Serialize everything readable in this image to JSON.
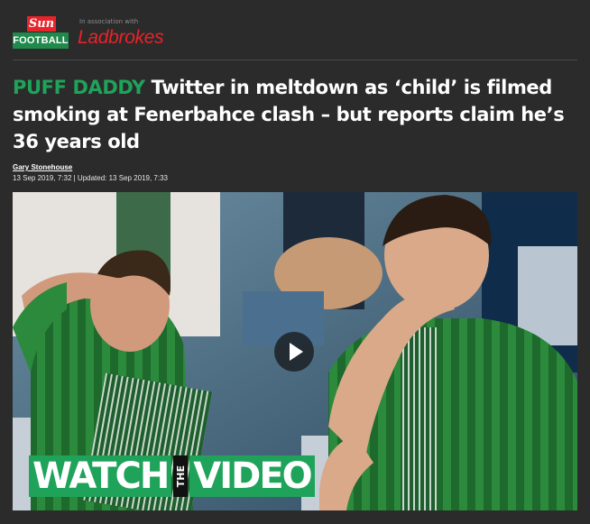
{
  "masthead": {
    "sun_label": "Sun",
    "football_label": "FOOTBALL",
    "association_text": "In association with",
    "sponsor_label": "Ladbrokes"
  },
  "article": {
    "kicker": "PUFF DADDY",
    "headline": " Twitter in meltdown as ‘child’ is filmed smoking at Fenerbahce clash – but reports claim he’s 36 years old",
    "author": "Gary Stonehouse",
    "dates": "13 Sep 2019, 7:32 | Updated: 13 Sep 2019, 7:33"
  },
  "video": {
    "overlay_word_1": "WATCH",
    "overlay_the": "THE",
    "overlay_word_2": "VIDEO",
    "play_icon": "play-icon"
  },
  "colors": {
    "background": "#2b2b2b",
    "accent_green": "#1fa35a",
    "sun_red": "#e8232a",
    "ladbrokes_red": "#e8232a"
  }
}
